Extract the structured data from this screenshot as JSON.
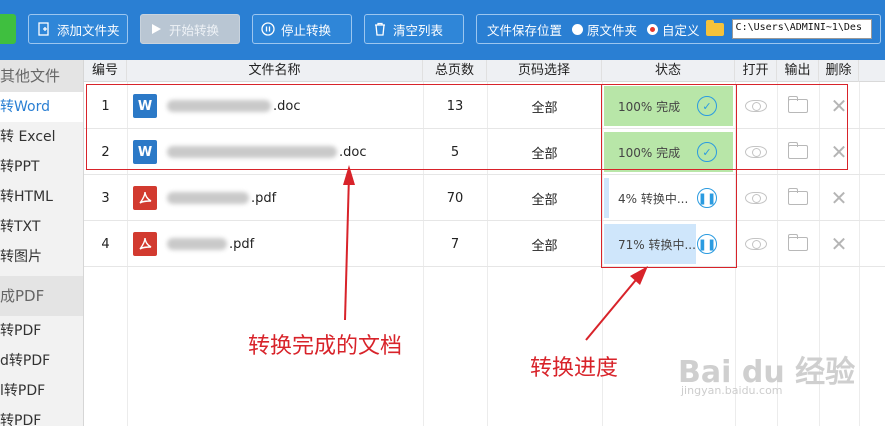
{
  "toolbar": {
    "buttons": [
      {
        "label": "添加文件夹",
        "icon": "add-folder-icon"
      },
      {
        "label": "开始转换",
        "icon": "play-icon"
      },
      {
        "label": "停止转换",
        "icon": "pause-icon"
      },
      {
        "label": "清空列表",
        "icon": "trash-icon"
      }
    ],
    "save_label": "文件保存位置",
    "option_original": "原文件夹",
    "option_custom": "自定义",
    "path_value": "C:\\Users\\ADMINI~1\\Des"
  },
  "sidebar": {
    "sections": [
      {
        "title": "其他文件",
        "items": [
          "转Word",
          "转 Excel",
          "转PPT",
          "转HTML",
          "转TXT",
          "转图片"
        ]
      },
      {
        "title": "成PDF",
        "items": [
          "转PDF",
          "d转PDF",
          "l转PDF",
          "转PDF"
        ]
      }
    ]
  },
  "table": {
    "headers": [
      "编号",
      "文件名称",
      "总页数",
      "页码选择",
      "状态",
      "打开",
      "输出",
      "删除"
    ],
    "rows": [
      {
        "num": "1",
        "type": "W",
        "name_suffix": ".doc",
        "pages": "13",
        "range": "全部",
        "status": "100% 完成",
        "progress": 100
      },
      {
        "num": "2",
        "type": "W",
        "name_suffix": ".doc",
        "pages": "5",
        "range": "全部",
        "status": "100% 完成",
        "progress": 100
      },
      {
        "num": "3",
        "type": "pdf",
        "name_suffix": ".pdf",
        "pages": "70",
        "range": "全部",
        "status": "4% 转换中...",
        "progress": 4
      },
      {
        "num": "4",
        "type": "pdf",
        "name_suffix": ".pdf",
        "pages": "7",
        "range": "全部",
        "status": "71% 转换中...",
        "progress": 71
      }
    ]
  },
  "annotations": {
    "done_note": "转换完成的文档",
    "progress_note": "转换进度"
  },
  "watermark": {
    "text": "Bai du 经验",
    "sub": "jingyan.baidu.com"
  },
  "colors": {
    "toolbar": "#2a7fd3",
    "annotation": "#d8232a",
    "done": "#b8e6a8",
    "progress": "#cfe6fb"
  }
}
